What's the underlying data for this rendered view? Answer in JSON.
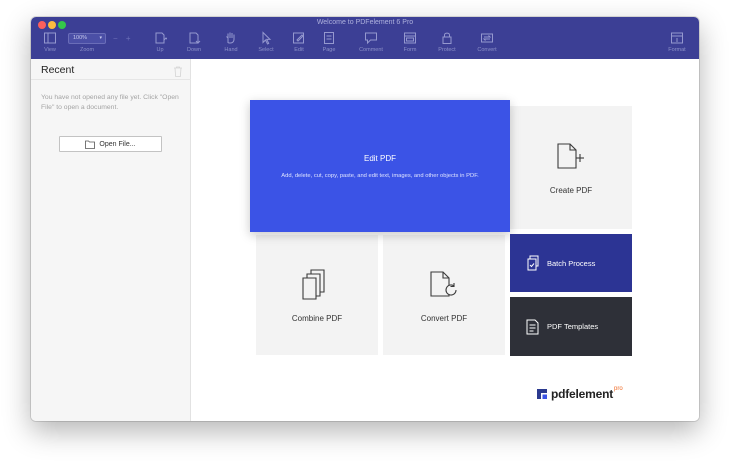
{
  "window": {
    "title": "Welcome to PDFelement 6 Pro"
  },
  "toolbar": {
    "zoom_value": "100%",
    "zoom_label": "Zoom",
    "items": [
      {
        "label": "View",
        "icon": "sidebar-view-icon"
      },
      {
        "label": "Up",
        "icon": "page-up-icon"
      },
      {
        "label": "Down",
        "icon": "page-down-icon"
      },
      {
        "label": "Hand",
        "icon": "hand-icon"
      },
      {
        "label": "Select",
        "icon": "cursor-icon"
      },
      {
        "label": "Edit",
        "icon": "edit-icon"
      },
      {
        "label": "Page",
        "icon": "page-icon"
      },
      {
        "label": "Comment",
        "icon": "comment-icon"
      },
      {
        "label": "Form",
        "icon": "form-icon"
      },
      {
        "label": "Protect",
        "icon": "lock-icon"
      },
      {
        "label": "Convert",
        "icon": "convert-icon"
      },
      {
        "label": "Format",
        "icon": "format-icon"
      }
    ]
  },
  "sidebar": {
    "title": "Recent",
    "empty_message": "You have not opened any file yet. Click \"Open File\" to open a document.",
    "open_button_label": "Open File..."
  },
  "main": {
    "edit_pdf": {
      "title": "Edit PDF",
      "description": "Add, delete, cut, copy, paste, and edit text, images, and other objects in PDF."
    },
    "create_pdf": {
      "label": "Create PDF"
    },
    "combine_pdf": {
      "label": "Combine PDF"
    },
    "convert_pdf": {
      "label": "Convert PDF"
    },
    "batch_process": {
      "label": "Batch Process"
    },
    "pdf_templates": {
      "label": "PDF Templates"
    }
  },
  "brand": {
    "name": "pdfelement",
    "edition": "pro"
  },
  "colors": {
    "titlebar": "#3c3f95",
    "edit_card": "#3b53e6",
    "batch_card": "#2c3494",
    "templates_card": "#2e3038",
    "brand_accent": "#f06a25"
  }
}
